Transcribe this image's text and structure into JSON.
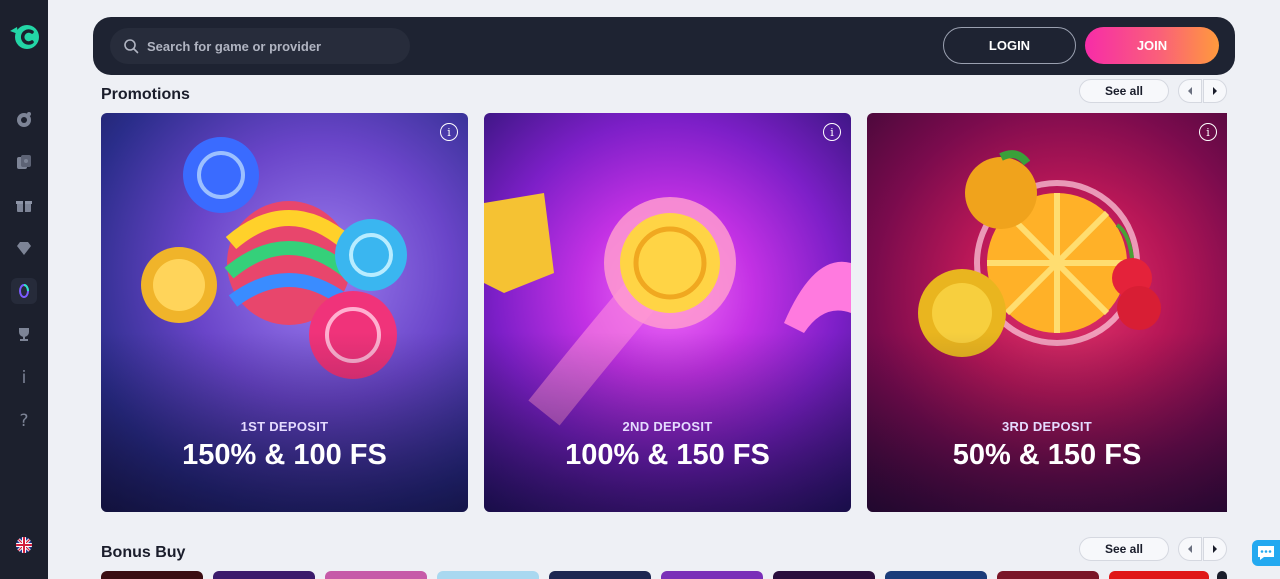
{
  "search": {
    "placeholder": "Search for game or provider"
  },
  "auth": {
    "login_label": "LOGIN",
    "join_label": "JOIN"
  },
  "promotions": {
    "title": "Promotions",
    "see_all": "See all",
    "cards": [
      {
        "subtitle": "1ST DEPOSIT",
        "headline": "150% & 100 FS"
      },
      {
        "subtitle": "2ND DEPOSIT",
        "headline": "100% & 150 FS"
      },
      {
        "subtitle": "3RD DEPOSIT",
        "headline": "50% & 150 FS"
      }
    ]
  },
  "bonus_buy": {
    "title": "Bonus Buy",
    "see_all": "See all"
  },
  "sidebar": {
    "items": [
      "casino-chip-icon",
      "cards-icon",
      "gift-icon",
      "diamond-icon",
      "ring-icon",
      "trophy-icon",
      "info-icon",
      "help-icon"
    ],
    "info_glyph": "i",
    "help_glyph": "?"
  },
  "colors": {
    "sidebar_bg": "#1c202d",
    "header_bg": "#1e2332",
    "join_gradient_start": "#f72ca8",
    "join_gradient_end": "#ff9a3c",
    "logo_accent": "#23d6a6"
  }
}
